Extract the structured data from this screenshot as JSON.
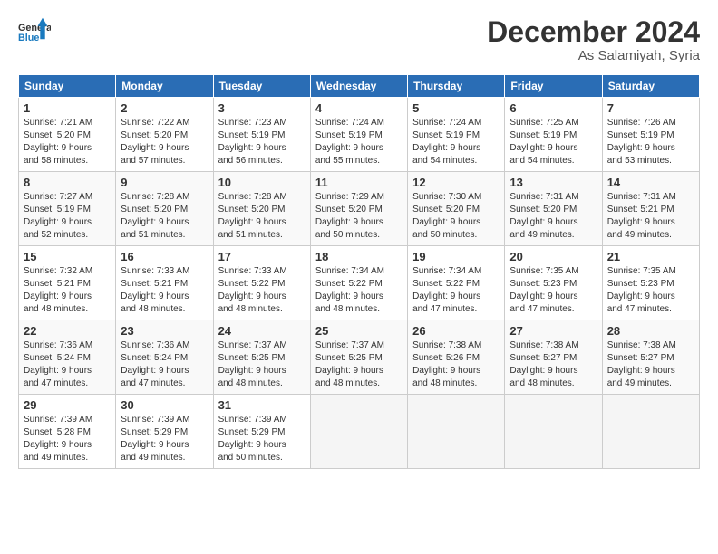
{
  "logo": {
    "line1": "General",
    "line2": "Blue"
  },
  "title": "December 2024",
  "subtitle": "As Salamiyah, Syria",
  "days_header": [
    "Sunday",
    "Monday",
    "Tuesday",
    "Wednesday",
    "Thursday",
    "Friday",
    "Saturday"
  ],
  "weeks": [
    [
      {
        "day": "1",
        "info": "Sunrise: 7:21 AM\nSunset: 5:20 PM\nDaylight: 9 hours\nand 58 minutes."
      },
      {
        "day": "2",
        "info": "Sunrise: 7:22 AM\nSunset: 5:20 PM\nDaylight: 9 hours\nand 57 minutes."
      },
      {
        "day": "3",
        "info": "Sunrise: 7:23 AM\nSunset: 5:19 PM\nDaylight: 9 hours\nand 56 minutes."
      },
      {
        "day": "4",
        "info": "Sunrise: 7:24 AM\nSunset: 5:19 PM\nDaylight: 9 hours\nand 55 minutes."
      },
      {
        "day": "5",
        "info": "Sunrise: 7:24 AM\nSunset: 5:19 PM\nDaylight: 9 hours\nand 54 minutes."
      },
      {
        "day": "6",
        "info": "Sunrise: 7:25 AM\nSunset: 5:19 PM\nDaylight: 9 hours\nand 54 minutes."
      },
      {
        "day": "7",
        "info": "Sunrise: 7:26 AM\nSunset: 5:19 PM\nDaylight: 9 hours\nand 53 minutes."
      }
    ],
    [
      {
        "day": "8",
        "info": "Sunrise: 7:27 AM\nSunset: 5:19 PM\nDaylight: 9 hours\nand 52 minutes."
      },
      {
        "day": "9",
        "info": "Sunrise: 7:28 AM\nSunset: 5:20 PM\nDaylight: 9 hours\nand 51 minutes."
      },
      {
        "day": "10",
        "info": "Sunrise: 7:28 AM\nSunset: 5:20 PM\nDaylight: 9 hours\nand 51 minutes."
      },
      {
        "day": "11",
        "info": "Sunrise: 7:29 AM\nSunset: 5:20 PM\nDaylight: 9 hours\nand 50 minutes."
      },
      {
        "day": "12",
        "info": "Sunrise: 7:30 AM\nSunset: 5:20 PM\nDaylight: 9 hours\nand 50 minutes."
      },
      {
        "day": "13",
        "info": "Sunrise: 7:31 AM\nSunset: 5:20 PM\nDaylight: 9 hours\nand 49 minutes."
      },
      {
        "day": "14",
        "info": "Sunrise: 7:31 AM\nSunset: 5:21 PM\nDaylight: 9 hours\nand 49 minutes."
      }
    ],
    [
      {
        "day": "15",
        "info": "Sunrise: 7:32 AM\nSunset: 5:21 PM\nDaylight: 9 hours\nand 48 minutes."
      },
      {
        "day": "16",
        "info": "Sunrise: 7:33 AM\nSunset: 5:21 PM\nDaylight: 9 hours\nand 48 minutes."
      },
      {
        "day": "17",
        "info": "Sunrise: 7:33 AM\nSunset: 5:22 PM\nDaylight: 9 hours\nand 48 minutes."
      },
      {
        "day": "18",
        "info": "Sunrise: 7:34 AM\nSunset: 5:22 PM\nDaylight: 9 hours\nand 48 minutes."
      },
      {
        "day": "19",
        "info": "Sunrise: 7:34 AM\nSunset: 5:22 PM\nDaylight: 9 hours\nand 47 minutes."
      },
      {
        "day": "20",
        "info": "Sunrise: 7:35 AM\nSunset: 5:23 PM\nDaylight: 9 hours\nand 47 minutes."
      },
      {
        "day": "21",
        "info": "Sunrise: 7:35 AM\nSunset: 5:23 PM\nDaylight: 9 hours\nand 47 minutes."
      }
    ],
    [
      {
        "day": "22",
        "info": "Sunrise: 7:36 AM\nSunset: 5:24 PM\nDaylight: 9 hours\nand 47 minutes."
      },
      {
        "day": "23",
        "info": "Sunrise: 7:36 AM\nSunset: 5:24 PM\nDaylight: 9 hours\nand 47 minutes."
      },
      {
        "day": "24",
        "info": "Sunrise: 7:37 AM\nSunset: 5:25 PM\nDaylight: 9 hours\nand 48 minutes."
      },
      {
        "day": "25",
        "info": "Sunrise: 7:37 AM\nSunset: 5:25 PM\nDaylight: 9 hours\nand 48 minutes."
      },
      {
        "day": "26",
        "info": "Sunrise: 7:38 AM\nSunset: 5:26 PM\nDaylight: 9 hours\nand 48 minutes."
      },
      {
        "day": "27",
        "info": "Sunrise: 7:38 AM\nSunset: 5:27 PM\nDaylight: 9 hours\nand 48 minutes."
      },
      {
        "day": "28",
        "info": "Sunrise: 7:38 AM\nSunset: 5:27 PM\nDaylight: 9 hours\nand 49 minutes."
      }
    ],
    [
      {
        "day": "29",
        "info": "Sunrise: 7:39 AM\nSunset: 5:28 PM\nDaylight: 9 hours\nand 49 minutes."
      },
      {
        "day": "30",
        "info": "Sunrise: 7:39 AM\nSunset: 5:29 PM\nDaylight: 9 hours\nand 49 minutes."
      },
      {
        "day": "31",
        "info": "Sunrise: 7:39 AM\nSunset: 5:29 PM\nDaylight: 9 hours\nand 50 minutes."
      },
      {
        "day": "",
        "info": ""
      },
      {
        "day": "",
        "info": ""
      },
      {
        "day": "",
        "info": ""
      },
      {
        "day": "",
        "info": ""
      }
    ]
  ]
}
